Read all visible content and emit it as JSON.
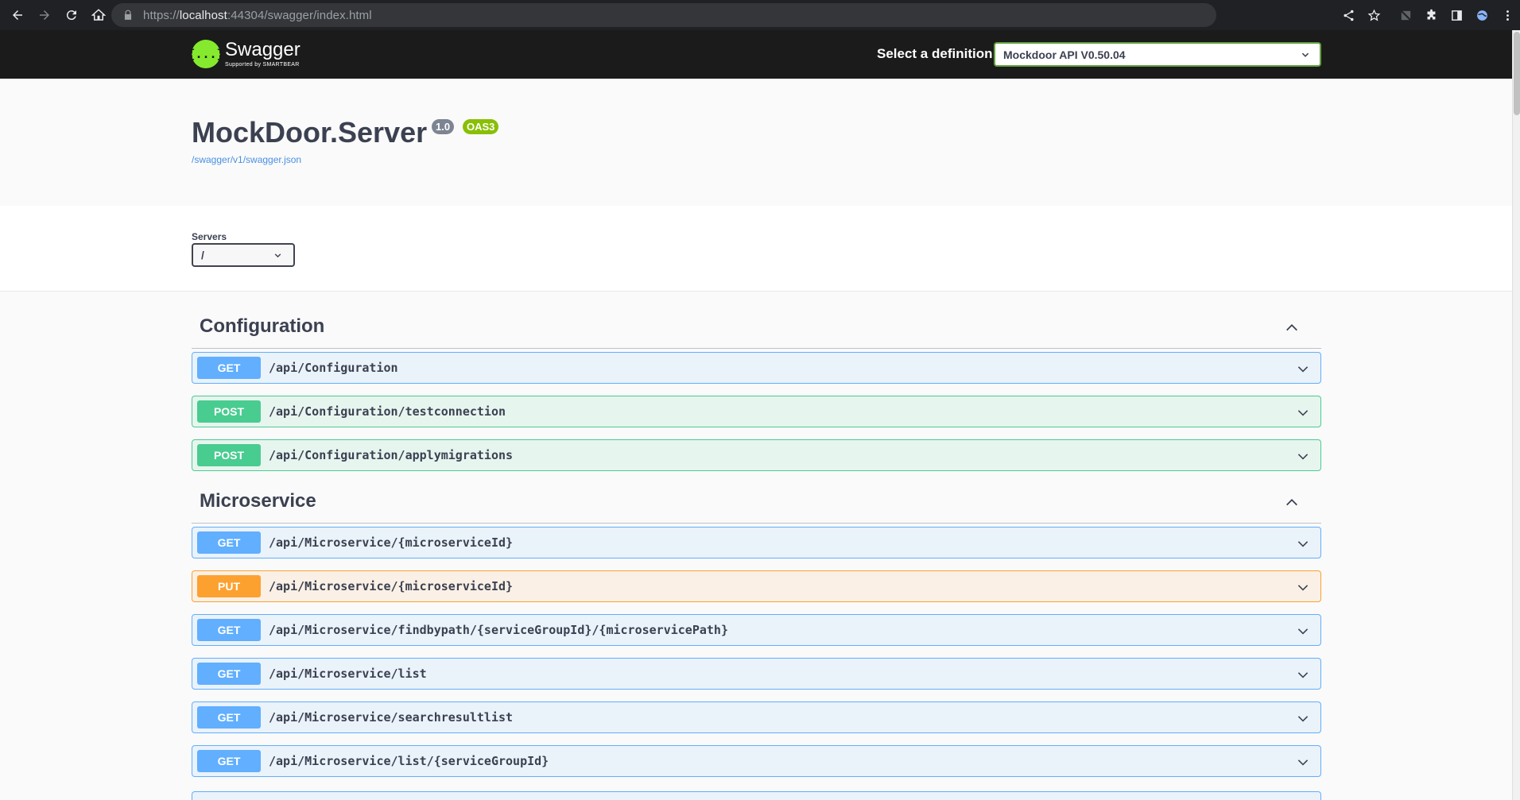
{
  "browser": {
    "url_scheme": "https://",
    "url_host": "localhost",
    "url_rest": ":44304/swagger/index.html"
  },
  "topbar": {
    "logo_name": "Swagger",
    "logo_sub": "Supported by SMARTBEAR",
    "definition_label": "Select a definition",
    "definition_value": "Mockdoor API V0.50.04"
  },
  "info": {
    "title": "MockDoor.Server",
    "version": "1.0",
    "oas": "OAS3",
    "spec_url": "/swagger/v1/swagger.json"
  },
  "servers": {
    "label": "Servers",
    "selected": "/"
  },
  "tags": [
    {
      "name": "Configuration",
      "operations": [
        {
          "method": "GET",
          "path": "/api/Configuration"
        },
        {
          "method": "POST",
          "path": "/api/Configuration/testconnection"
        },
        {
          "method": "POST",
          "path": "/api/Configuration/applymigrations"
        }
      ]
    },
    {
      "name": "Microservice",
      "operations": [
        {
          "method": "GET",
          "path": "/api/Microservice/{microserviceId}"
        },
        {
          "method": "PUT",
          "path": "/api/Microservice/{microserviceId}"
        },
        {
          "method": "GET",
          "path": "/api/Microservice/findbypath/{serviceGroupId}/{microservicePath}"
        },
        {
          "method": "GET",
          "path": "/api/Microservice/list"
        },
        {
          "method": "GET",
          "path": "/api/Microservice/searchresultlist"
        },
        {
          "method": "GET",
          "path": "/api/Microservice/list/{serviceGroupId}"
        }
      ]
    }
  ],
  "colors": {
    "get": "#61affe",
    "post": "#49cc90",
    "put": "#fca130",
    "swagger_green": "#85ea2d"
  }
}
